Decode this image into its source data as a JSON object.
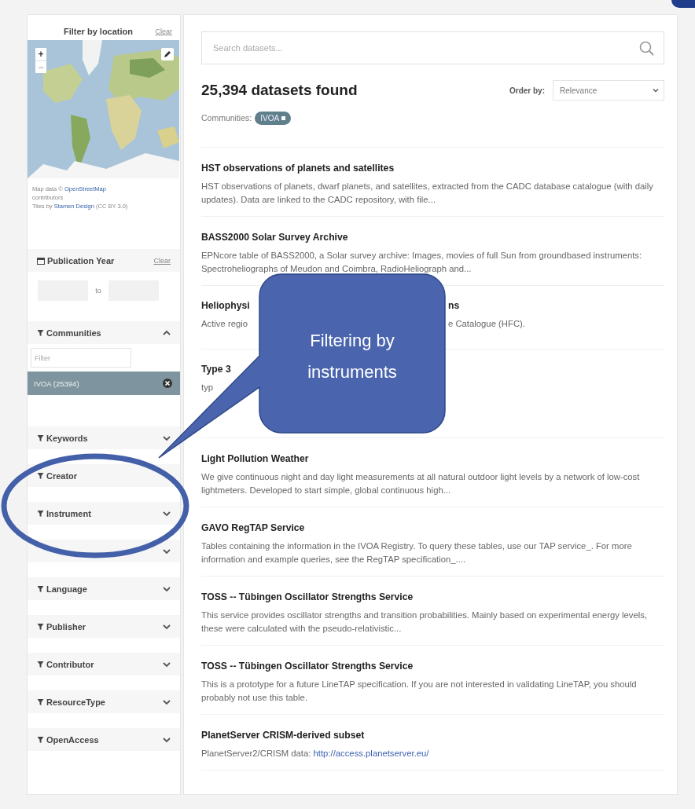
{
  "location_filter": {
    "title": "Filter by location",
    "clear": "Clear",
    "zoom_in": "+",
    "zoom_out": "−",
    "attribution": [
      {
        "text": "Map data © ",
        "link": "OpenStreetMap"
      },
      {
        "text": "contributors"
      },
      {
        "text": "Tiles by ",
        "link": "Stamen Design",
        "after": " (CC BY 3.0)"
      }
    ]
  },
  "publication_year": {
    "title": "Publication Year",
    "clear": "Clear",
    "separator": "to"
  },
  "facets": [
    {
      "kind": "facet",
      "label": "Communities",
      "expanded": true,
      "filter": {
        "placeholder": "Filter"
      },
      "values": [
        {
          "label": "IVOA (25394)",
          "selected": true
        }
      ]
    },
    {
      "kind": "facet",
      "label": "Keywords",
      "expanded": false
    },
    {
      "kind": "facet",
      "label": "Creator"
    },
    {
      "kind": "facet",
      "label": "Instrument",
      "expanded": false
    },
    {
      "kind": "covered",
      "expanded": false
    },
    {
      "kind": "facet",
      "label": "Language",
      "expanded": false
    },
    {
      "kind": "facet",
      "label": "Publisher",
      "expanded": false
    },
    {
      "kind": "facet",
      "label": "Contributor",
      "expanded": false
    },
    {
      "kind": "facet",
      "label": "ResourceType",
      "expanded": false
    },
    {
      "kind": "facet",
      "label": "OpenAccess",
      "expanded": false
    }
  ],
  "search": {
    "placeholder": "Search datasets..."
  },
  "results_heading": "25,394 datasets found",
  "order_by": {
    "label": "Order by:",
    "value": "Relevance"
  },
  "active_filters": {
    "label": "Communities:",
    "chips": [
      "IVOA"
    ]
  },
  "results": [
    {
      "kind": "full",
      "title": "HST observations of planets and satellites",
      "description": "HST observations of planets, dwarf planets, and satellites, extracted from the CADC database catalogue (with daily updates). Data are linked to the CADC repository, with file..."
    },
    {
      "kind": "full",
      "title": "BASS2000 Solar Survey Archive",
      "description": "EPNcore table of BASS2000, a Solar survey archive: Images, movies of full Sun from groundbased instruments: Spectroheliographs of Meudon and Coimbra, RadioHeliograph and..."
    },
    {
      "kind": "covered",
      "title_fragments": [
        "Heliophysi",
        "ns"
      ],
      "description_fragments": [
        "Active regio",
        "e Catalogue (HFC)."
      ]
    },
    {
      "kind": "covered",
      "title_fragments": [
        "Type 3"
      ],
      "description_fragments": [
        "typ"
      ]
    },
    {
      "kind": "full",
      "title": "Light Pollution Weather",
      "description": "We give continuous night and day light measurements at all natural outdoor light levels by a network of low-cost lightmeters. Developed to start simple, global continuous high..."
    },
    {
      "kind": "full",
      "title": "GAVO RegTAP Service",
      "description": "Tables containing the information in the IVOA Registry. To query these tables, use our TAP service_. For more information and example queries, see the RegTAP specification_...."
    },
    {
      "kind": "full",
      "title": "TOSS -- Tübingen Oscillator Strengths Service",
      "description": "This service provides oscillator strengths and transition probabilities. Mainly based on experimental energy levels, these were calculated with the pseudo-relativistic..."
    },
    {
      "kind": "full",
      "title": "TOSS -- Tübingen Oscillator Strengths Service",
      "description": "This is a prototype for a future LineTAP specification. If you are not interested in validating LineTAP, you should probably not use this table."
    },
    {
      "kind": "full",
      "title": "PlanetServer CRISM-derived subset",
      "description": "PlanetServer2/CRISM data: ",
      "link": "http://access.planetserver.eu/"
    }
  ],
  "callout": {
    "lines": [
      "Filtering by",
      "instruments"
    ]
  }
}
